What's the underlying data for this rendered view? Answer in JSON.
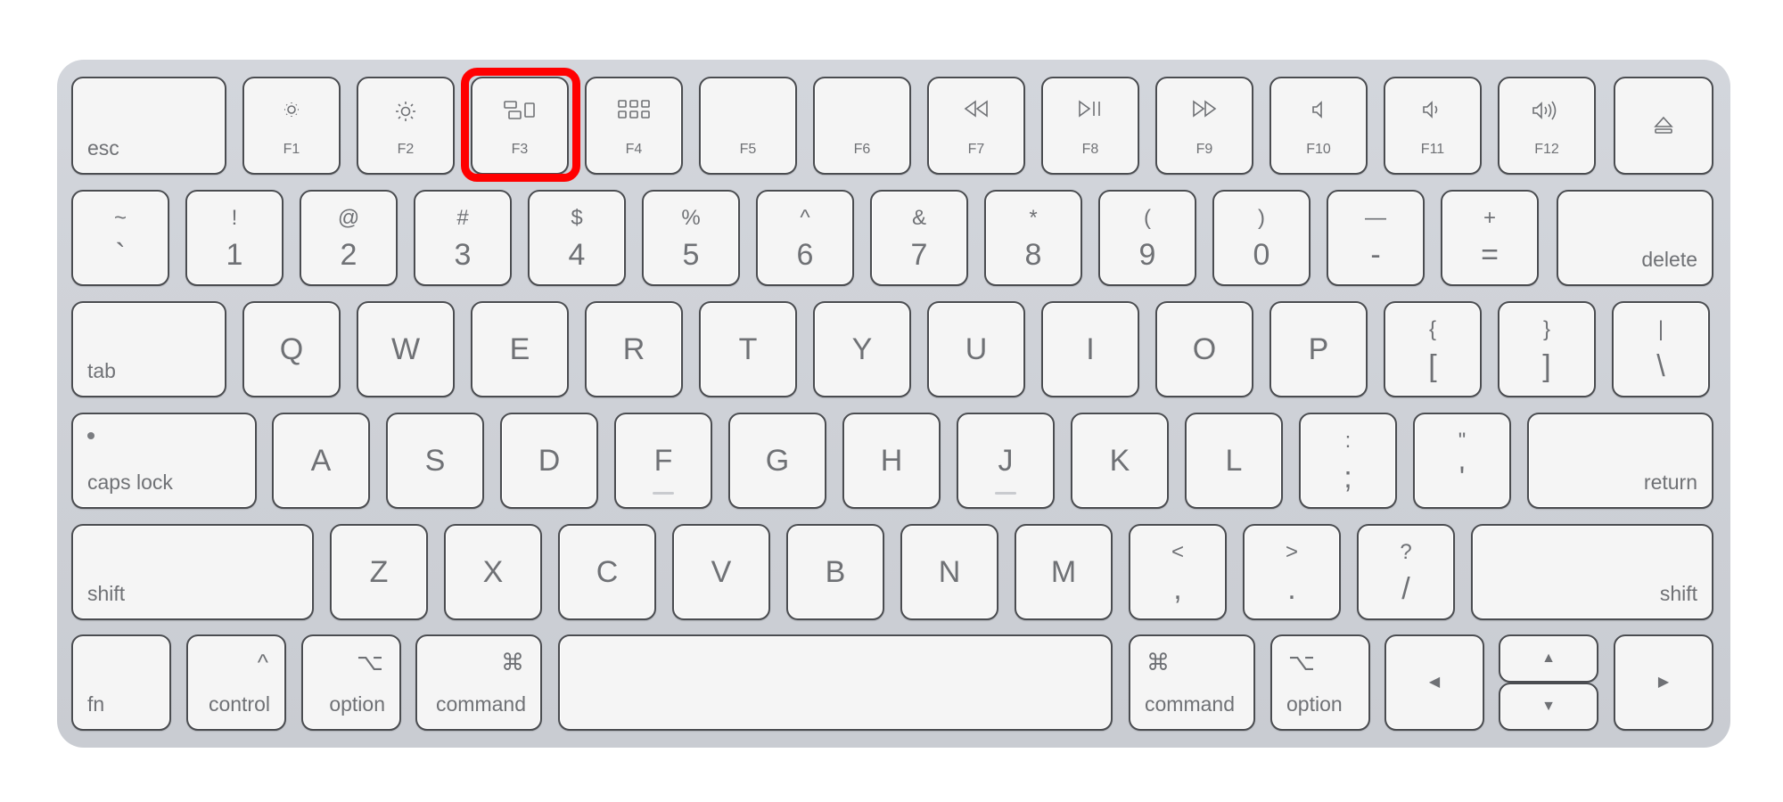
{
  "keyboard": {
    "highlighted_key": "F3",
    "highlight_color": "#ff0000",
    "function_row": {
      "esc": "esc",
      "keys": [
        {
          "label": "F1",
          "icon": "brightness-down-icon"
        },
        {
          "label": "F2",
          "icon": "brightness-up-icon"
        },
        {
          "label": "F3",
          "icon": "mission-control-icon"
        },
        {
          "label": "F4",
          "icon": "launchpad-icon"
        },
        {
          "label": "F5",
          "icon": ""
        },
        {
          "label": "F6",
          "icon": ""
        },
        {
          "label": "F7",
          "icon": "rewind-icon"
        },
        {
          "label": "F8",
          "icon": "play-pause-icon"
        },
        {
          "label": "F9",
          "icon": "fast-forward-icon"
        },
        {
          "label": "F10",
          "icon": "mute-icon"
        },
        {
          "label": "F11",
          "icon": "volume-down-icon"
        },
        {
          "label": "F12",
          "icon": "volume-up-icon"
        }
      ],
      "eject_icon": "eject-icon"
    },
    "number_row": [
      {
        "top": "~",
        "bottom": "`"
      },
      {
        "top": "!",
        "bottom": "1"
      },
      {
        "top": "@",
        "bottom": "2"
      },
      {
        "top": "#",
        "bottom": "3"
      },
      {
        "top": "$",
        "bottom": "4"
      },
      {
        "top": "%",
        "bottom": "5"
      },
      {
        "top": "^",
        "bottom": "6"
      },
      {
        "top": "&",
        "bottom": "7"
      },
      {
        "top": "*",
        "bottom": "8"
      },
      {
        "top": "(",
        "bottom": "9"
      },
      {
        "top": ")",
        "bottom": "0"
      },
      {
        "top": "—",
        "bottom": "-"
      },
      {
        "top": "+",
        "bottom": "="
      }
    ],
    "delete": "delete",
    "tab": "tab",
    "qwerty_row": [
      "Q",
      "W",
      "E",
      "R",
      "T",
      "Y",
      "U",
      "I",
      "O",
      "P"
    ],
    "bracket_keys": [
      {
        "top": "{",
        "bottom": "["
      },
      {
        "top": "}",
        "bottom": "]"
      },
      {
        "top": "|",
        "bottom": "\\"
      }
    ],
    "caps_lock": "caps lock",
    "home_row": [
      "A",
      "S",
      "D",
      "F",
      "G",
      "H",
      "J",
      "K",
      "L"
    ],
    "home_punct": [
      {
        "top": ":",
        "bottom": ";"
      },
      {
        "top": "\"",
        "bottom": "'"
      }
    ],
    "return": "return",
    "shift_left": "shift",
    "bottom_letters": [
      "Z",
      "X",
      "C",
      "V",
      "B",
      "N",
      "M"
    ],
    "bottom_punct": [
      {
        "top": "<",
        "bottom": ","
      },
      {
        "top": ">",
        "bottom": "."
      },
      {
        "top": "?",
        "bottom": "/"
      }
    ],
    "shift_right": "shift",
    "modifiers": {
      "fn": "fn",
      "control": "control",
      "control_symbol": "^",
      "option": "option",
      "option_symbol": "⌥",
      "command": "command",
      "command_symbol": "⌘"
    },
    "arrows": {
      "left": "◀",
      "up": "▲",
      "down": "▼",
      "right": "▶"
    }
  }
}
